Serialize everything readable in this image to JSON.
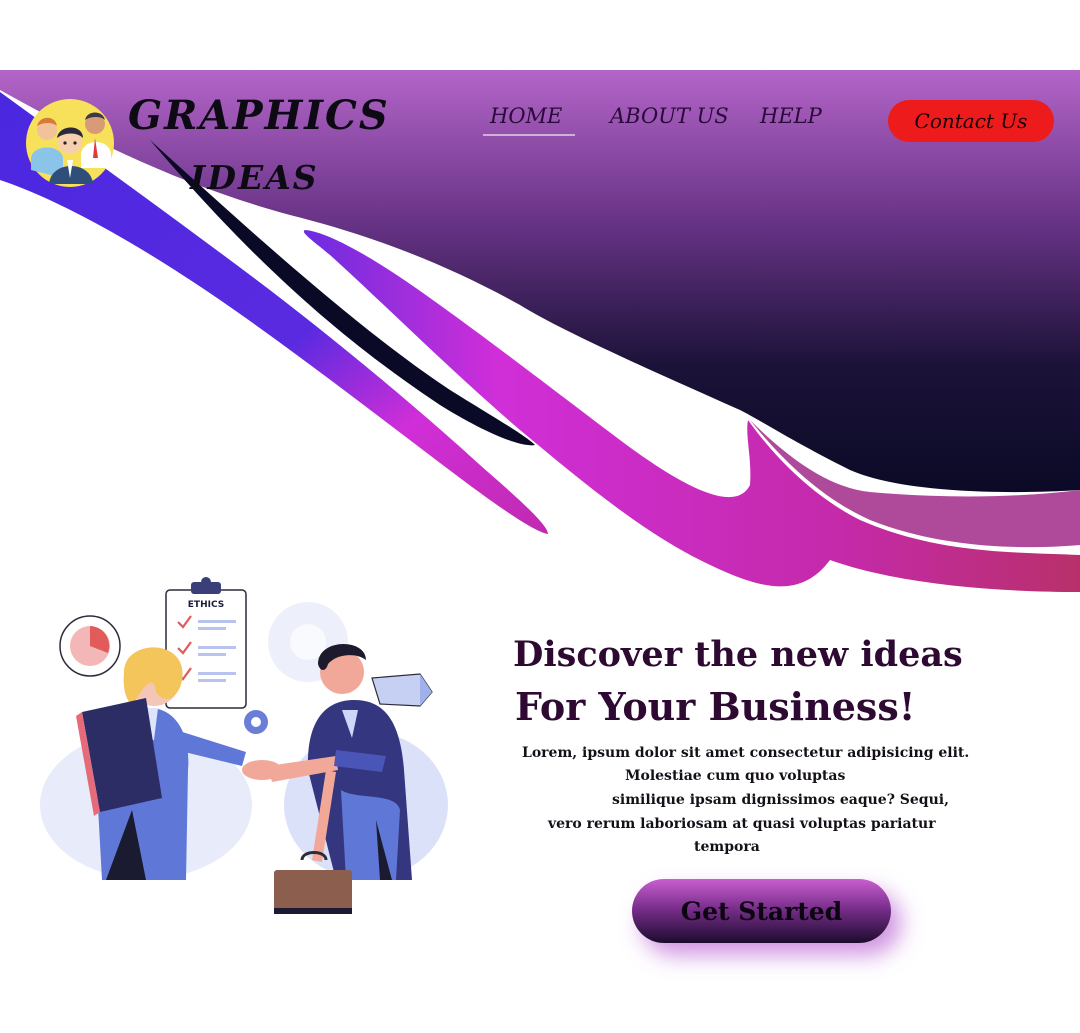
{
  "brand": {
    "line1": "GRAPHICS",
    "line2": "IDEAS"
  },
  "nav": {
    "home": "HOME",
    "about": "ABOUT US",
    "help": "HELP",
    "contact": "Contact Us",
    "active_item": "HOME"
  },
  "hero": {
    "headline_line1": "Discover the new ideas",
    "headline_line2": "For Your Business!",
    "body_lines": [
      "Lorem, ipsum dolor sit amet consectetur adipisicing elit.",
      "Molestiae cum quo voluptas",
      "similique ipsam dignissimos eaque? Sequi,",
      "vero rerum laboriosam at quasi voluptas pariatur",
      "tempora"
    ],
    "cta_label": "Get Started"
  },
  "illustration": {
    "clipboard_label": "ETHICS"
  },
  "icons": {
    "logo": "team-avatar-icon",
    "illustration": "business-handshake-illustration",
    "pie": "pie-chart-icon",
    "gear": "gear-icon",
    "paper_plane": "paper-plane-icon",
    "briefcase": "briefcase-icon",
    "checkmark": "checkmark-icon"
  },
  "colors": {
    "contact_button": "#ed1b1b",
    "hero_purple_top": "#b365c8",
    "hero_navy": "#0b0a26",
    "stripe_blue": "#4a28e0",
    "stripe_magenta": "#d02ed8",
    "stripe_pink": "#b8306a",
    "headline": "#2e0a33",
    "cta_gradient_top": "#c95fd0",
    "cta_gradient_bottom": "#1c0b2e"
  }
}
